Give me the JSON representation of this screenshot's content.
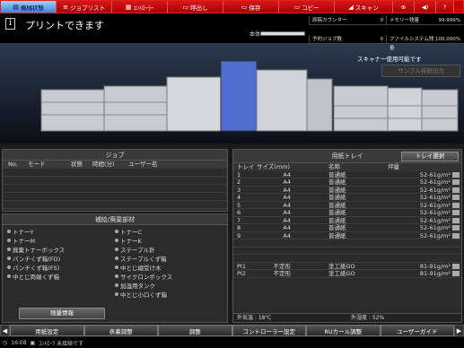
{
  "toolbar": {
    "items": [
      {
        "label": "機械状態",
        "icon": "machine-icon"
      },
      {
        "label": "ジョブリスト",
        "icon": "list-icon"
      },
      {
        "label": "ｺﾝﾄﾛｰﾗｰ",
        "icon": "controller-icon"
      },
      {
        "label": "呼出し",
        "icon": "folder-icon"
      },
      {
        "label": "保存",
        "icon": "save-icon"
      },
      {
        "label": "コピー",
        "icon": "copy-icon"
      },
      {
        "label": "スキャン",
        "icon": "scan-icon"
      }
    ],
    "globe_symbol": "⊕",
    "volume_symbol": "◀)",
    "help_label": "?",
    "active_color": "#3a88d8",
    "bar_color": "#c40000"
  },
  "status": {
    "message": "プリントできます",
    "toner_label": "本体",
    "toner_level": 1.0
  },
  "counters": {
    "items": [
      {
        "label": "原稿カウンター",
        "value": "0"
      },
      {
        "label": "メモリー残量",
        "value": "99.999%"
      },
      {
        "label": "予約ジョブ数",
        "value": "0"
      },
      {
        "label": "ファイルシステム残量",
        "value": "100.000%"
      }
    ]
  },
  "machine": {
    "scanner_status": "スキャナー使用可能です",
    "sample_button": "サンプル排紙出力"
  },
  "jobs": {
    "title": "ジョブ",
    "columns": [
      "No.",
      "モード",
      "状態",
      "時間(分)",
      "ユーザー名"
    ]
  },
  "supplies": {
    "title": "補給/廃棄部材",
    "items": [
      "トナーY",
      "トナーC",
      "トナーM",
      "トナーK",
      "廃棄トナーボックス",
      "ステープル針",
      "パンチくず箱(FD)",
      "ステープルくず箱",
      "パンチくず箱(FS)",
      "中とじ綴受け木",
      "中とじ両端くず箱",
      "サイクロンボックス",
      "",
      "加湿用タンク",
      "",
      "中とじ小口くず箱"
    ],
    "button": "残量情報"
  },
  "trays": {
    "title": "用紙トレイ",
    "select_button": "トレイ選択",
    "columns": [
      "トレイ",
      "サイズ(mm)",
      "名称",
      "坪量"
    ],
    "rows": [
      {
        "tray": "1",
        "size": "A4",
        "name": "普通紙",
        "weight": "52-61g/m²"
      },
      {
        "tray": "2",
        "size": "A4",
        "name": "普通紙",
        "weight": "52-61g/m²"
      },
      {
        "tray": "3",
        "size": "A4",
        "name": "普通紙",
        "weight": "52-61g/m²"
      },
      {
        "tray": "4",
        "size": "A4",
        "name": "普通紙",
        "weight": "52-61g/m²"
      },
      {
        "tray": "5",
        "size": "A4",
        "name": "普通紙",
        "weight": "52-61g/m²"
      },
      {
        "tray": "6",
        "size": "A4",
        "name": "普通紙",
        "weight": "52-61g/m²"
      },
      {
        "tray": "7",
        "size": "A4",
        "name": "普通紙",
        "weight": "52-61g/m²"
      },
      {
        "tray": "8",
        "size": "A4",
        "name": "普通紙",
        "weight": "52-61g/m²"
      },
      {
        "tray": "9",
        "size": "A4",
        "name": "普通紙",
        "weight": "52-61g/m²"
      },
      {
        "tray": "",
        "size": "",
        "name": "",
        "weight": ""
      },
      {
        "tray": "",
        "size": "",
        "name": "",
        "weight": ""
      },
      {
        "tray": "",
        "size": "",
        "name": "",
        "weight": ""
      },
      {
        "tray": "PI1",
        "size": "不定形",
        "name": "塗工紙GO",
        "weight": "81-91g/m²"
      },
      {
        "tray": "PI2",
        "size": "不定形",
        "name": "塗工紙GO",
        "weight": "81-91g/m²"
      }
    ],
    "outside_temp_label": "外気温",
    "outside_temp_value": "18℃",
    "outside_humidity_label": "外湿度",
    "outside_humidity_value": "52%"
  },
  "menubar": {
    "items": [
      "用紙設定",
      "表裏調整",
      "調整",
      "コントローラー設定",
      "RUカール調整",
      "ユーザーガイド"
    ]
  },
  "footer": {
    "time": "16:08",
    "message": "ｺﾝﾄﾛｰﾗ 未接続です"
  }
}
